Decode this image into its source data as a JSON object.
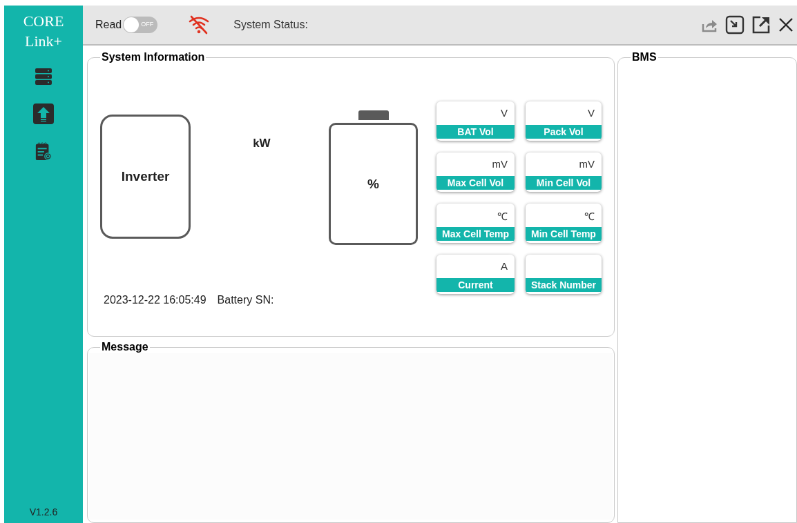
{
  "sidebar": {
    "logo_line_1": "CORE",
    "logo_line_2": "Link+",
    "version": "V1.2.6"
  },
  "toolbar": {
    "read_label": "Read",
    "read_toggle": {
      "on": false,
      "label": "OFF"
    },
    "wifi_connected": false,
    "status_label": "System Status:"
  },
  "system_information": {
    "title": "System Information",
    "inverter_label": "Inverter",
    "power_unit": "kW",
    "battery_unit": "%",
    "cards": [
      {
        "unit": "V",
        "label": "BAT Vol"
      },
      {
        "unit": "V",
        "label": "Pack Vol"
      },
      {
        "unit": "mV",
        "label": "Max Cell Vol"
      },
      {
        "unit": "mV",
        "label": "Min Cell Vol"
      },
      {
        "unit": "℃",
        "label": "Max Cell Temp"
      },
      {
        "unit": "℃",
        "label": "Min Cell Temp"
      },
      {
        "unit": "A",
        "label": "Current"
      },
      {
        "label": "Stack Number"
      }
    ],
    "timestamp": "2023-12-22 16:05:49",
    "battery_sn_label": "Battery SN:"
  },
  "message": {
    "title": "Message"
  },
  "bms": {
    "title": "BMS"
  }
}
